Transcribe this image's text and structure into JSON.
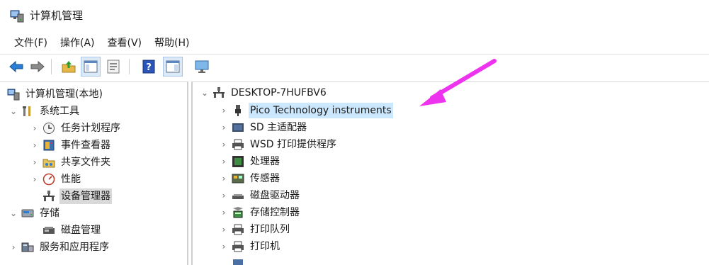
{
  "window": {
    "title": "计算机管理"
  },
  "menu": [
    "文件(F)",
    "操作(A)",
    "查看(V)",
    "帮助(H)"
  ],
  "toolbar": {
    "icons": [
      "back-arrow-icon",
      "forward-arrow-icon",
      "up-folder-icon",
      "show-hide-console-tree-icon",
      "properties-icon",
      "help-icon",
      "action-pane-icon",
      "monitor-icon"
    ]
  },
  "left_tree": [
    {
      "label": "计算机管理(本地)",
      "expander": ""
    },
    {
      "label": "系统工具",
      "expander": "⌄"
    },
    {
      "label": "任务计划程序",
      "expander": "›"
    },
    {
      "label": "事件查看器",
      "expander": "›"
    },
    {
      "label": "共享文件夹",
      "expander": "›"
    },
    {
      "label": "性能",
      "expander": "›"
    },
    {
      "label": "设备管理器",
      "expander": ""
    },
    {
      "label": "存储",
      "expander": "⌄"
    },
    {
      "label": "磁盘管理",
      "expander": ""
    },
    {
      "label": "服务和应用程序",
      "expander": "›"
    }
  ],
  "device_tree": {
    "root": {
      "label": "DESKTOP-7HUFBV6",
      "expander": "⌄"
    },
    "items": [
      {
        "label": "Pico Technology instruments",
        "expander": "›"
      },
      {
        "label": "SD 主适配器",
        "expander": "›"
      },
      {
        "label": "WSD 打印提供程序",
        "expander": "›"
      },
      {
        "label": "处理器",
        "expander": "›"
      },
      {
        "label": "传感器",
        "expander": "›"
      },
      {
        "label": "磁盘驱动器",
        "expander": "›"
      },
      {
        "label": "存储控制器",
        "expander": "›"
      },
      {
        "label": "打印队列",
        "expander": "›"
      },
      {
        "label": "打印机",
        "expander": "›"
      }
    ]
  },
  "colors": {
    "annotation_arrow": "#ee33ee",
    "selection": "#d9d9d9",
    "highlight": "#cce8ff"
  }
}
